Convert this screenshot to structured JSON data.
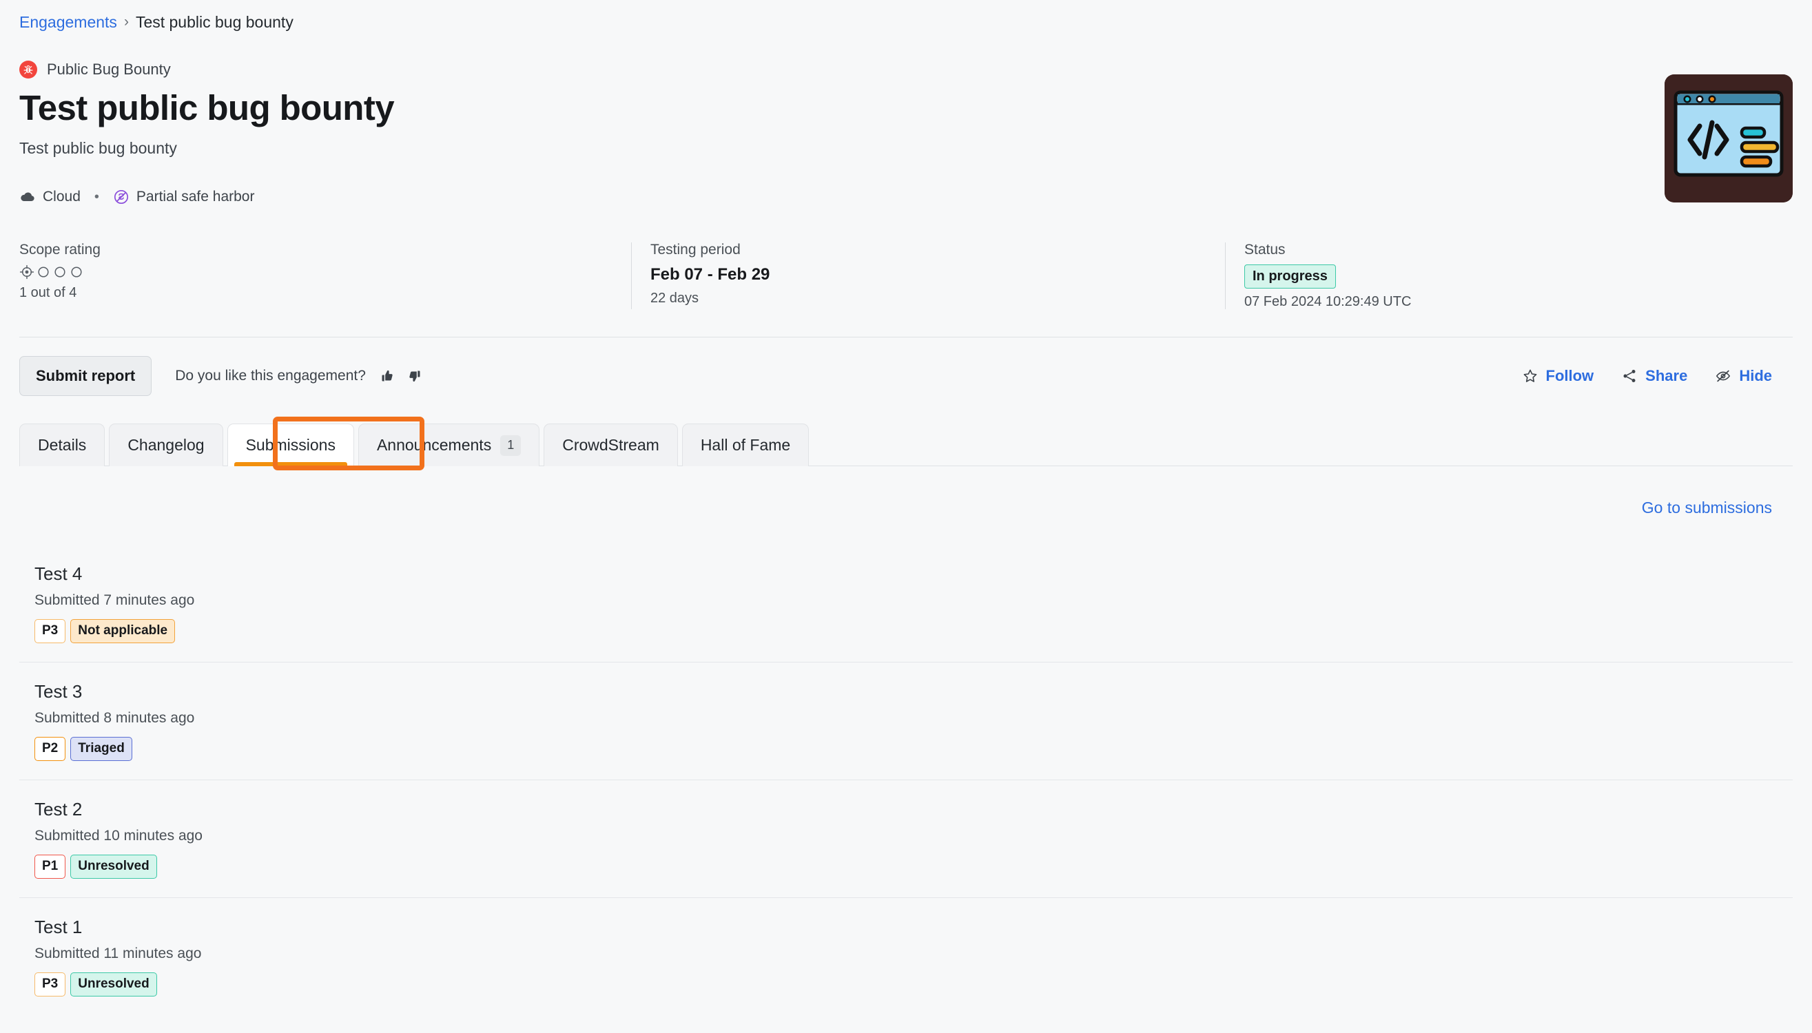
{
  "breadcrumb": {
    "root": "Engagements",
    "separator": "›",
    "current": "Test public bug bounty"
  },
  "header": {
    "kind_icon": "bug-icon",
    "kind_label": "Public Bug Bounty",
    "title": "Test public bug bounty",
    "subtitle": "Test public bug bounty",
    "meta": [
      {
        "icon": "cloud-icon",
        "label": "Cloud"
      },
      {
        "icon": "safe-harbor-icon",
        "label": "Partial safe harbor"
      }
    ],
    "thumbnail_icon": "code-window-thumbnail"
  },
  "stats": {
    "scope": {
      "label": "Scope rating",
      "filled": 1,
      "total": 4,
      "value_text": "1 out of 4"
    },
    "testing_period": {
      "label": "Testing period",
      "range": "Feb 07 - Feb 29",
      "duration": "22 days"
    },
    "status": {
      "label": "Status",
      "badge": "In progress",
      "badge_color": "#3cc9a7",
      "timestamp": "07 Feb 2024 10:29:49 UTC"
    }
  },
  "actions": {
    "submit_report": "Submit report",
    "like_question": "Do you like this engagement?",
    "thumbs_up_icon": "thumbs-up-icon",
    "thumbs_down_icon": "thumbs-down-icon",
    "follow": "Follow",
    "share": "Share",
    "hide": "Hide",
    "link_color": "#2d6ddf"
  },
  "tabs": {
    "active_index": 2,
    "highlight_color": "#f2711c",
    "items": [
      {
        "label": "Details",
        "badge": null
      },
      {
        "label": "Changelog",
        "badge": null
      },
      {
        "label": "Submissions",
        "badge": null
      },
      {
        "label": "Announcements",
        "badge": "1"
      },
      {
        "label": "CrowdStream",
        "badge": null
      },
      {
        "label": "Hall of Fame",
        "badge": null
      }
    ]
  },
  "submissions_panel": {
    "go_link": "Go to submissions",
    "items": [
      {
        "title": "Test 4",
        "time": "Submitted 7 minutes ago",
        "priority": "P3",
        "priority_class": "pri-p3",
        "status": "Not applicable",
        "status_class": "st-notapplicable"
      },
      {
        "title": "Test 3",
        "time": "Submitted 8 minutes ago",
        "priority": "P2",
        "priority_class": "pri-p2",
        "status": "Triaged",
        "status_class": "st-triaged"
      },
      {
        "title": "Test 2",
        "time": "Submitted 10 minutes ago",
        "priority": "P1",
        "priority_class": "pri-p1",
        "status": "Unresolved",
        "status_class": "st-unresolved"
      },
      {
        "title": "Test 1",
        "time": "Submitted 11 minutes ago",
        "priority": "P3",
        "priority_class": "pri-p3",
        "status": "Unresolved",
        "status_class": "st-unresolved"
      }
    ]
  }
}
